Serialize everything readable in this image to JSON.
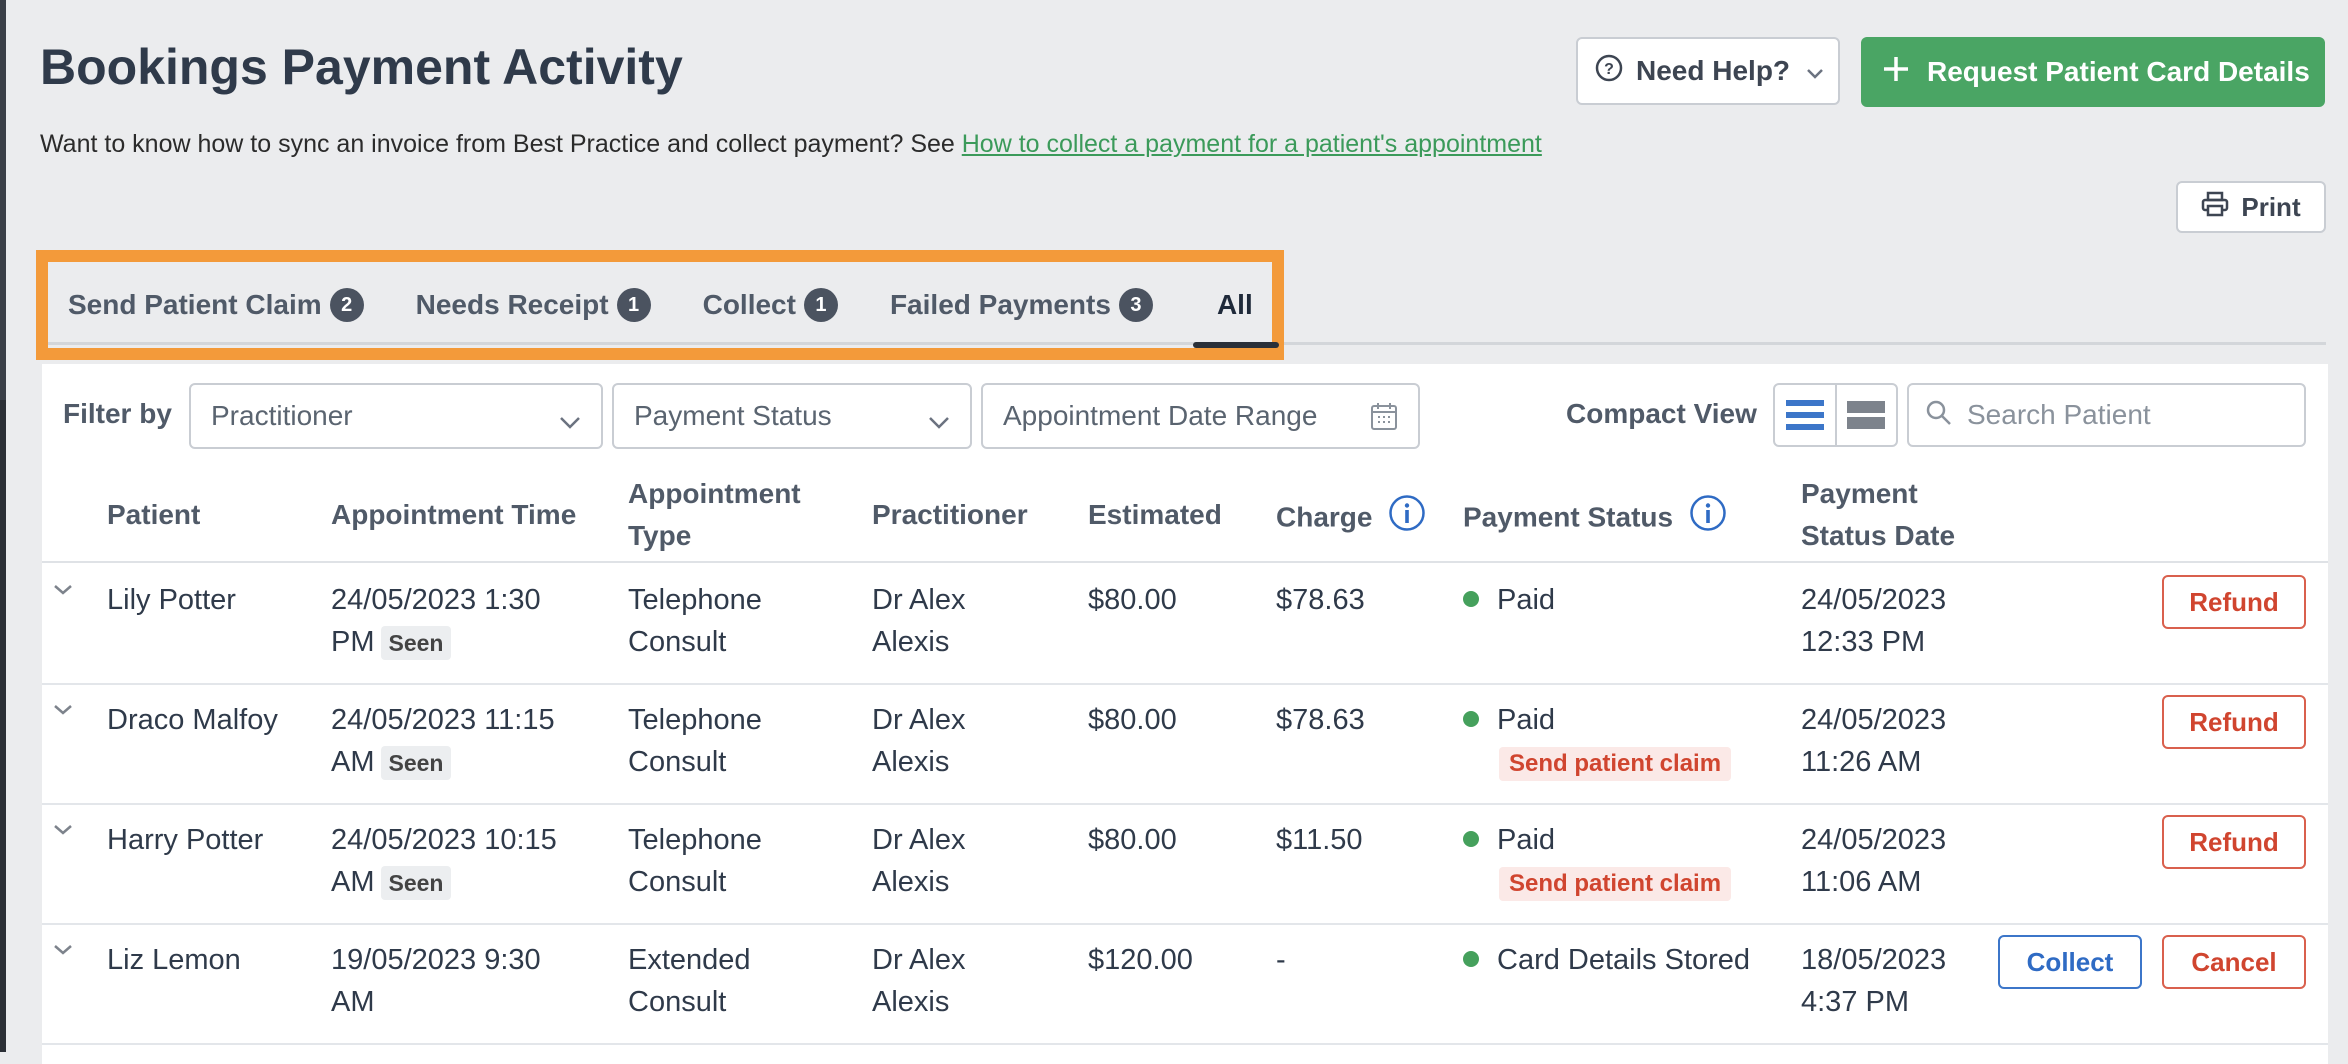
{
  "header": {
    "title": "Bookings Payment Activity",
    "subtext": "Want to know how to sync an invoice from Best Practice and collect payment? See",
    "link_text": "How to collect a payment for a patient's appointment",
    "help_button": "Need Help?",
    "request_button": "Request Patient Card Details",
    "print_button": "Print"
  },
  "tabs": [
    {
      "label": "Send Patient Claim",
      "count": "2"
    },
    {
      "label": "Needs Receipt",
      "count": "1"
    },
    {
      "label": "Collect",
      "count": "1"
    },
    {
      "label": "Failed Payments",
      "count": "3"
    },
    {
      "label": "All",
      "count": ""
    }
  ],
  "filters": {
    "label": "Filter by",
    "practitioner": "Practitioner",
    "payment_status": "Payment Status",
    "date_range": "Appointment Date Range",
    "compact_view": "Compact View",
    "search_placeholder": "Search Patient"
  },
  "columns": {
    "patient": "Patient",
    "appointment_time": "Appointment Time",
    "appointment_type_1": "Appointment",
    "appointment_type_2": "Type",
    "practitioner": "Practitioner",
    "estimated": "Estimated",
    "charge": "Charge",
    "payment_status": "Payment Status",
    "status_date_1": "Payment",
    "status_date_2": "Status Date"
  },
  "rows": [
    {
      "patient": "Lily Potter",
      "time_1": "24/05/2023 1:30",
      "time_2": "PM",
      "seen": "Seen",
      "type_1": "Telephone",
      "type_2": "Consult",
      "prac_1": "Dr Alex",
      "prac_2": "Alexis",
      "estimated": "$80.00",
      "charge": "$78.63",
      "status": "Paid",
      "claim": "",
      "date_1": "24/05/2023",
      "date_2": "12:33 PM",
      "action": "Refund"
    },
    {
      "patient": "Draco Malfoy",
      "time_1": "24/05/2023 11:15",
      "time_2": "AM",
      "seen": "Seen",
      "type_1": "Telephone",
      "type_2": "Consult",
      "prac_1": "Dr Alex",
      "prac_2": "Alexis",
      "estimated": "$80.00",
      "charge": "$78.63",
      "status": "Paid",
      "claim": "Send patient claim",
      "date_1": "24/05/2023",
      "date_2": "11:26 AM",
      "action": "Refund"
    },
    {
      "patient": "Harry Potter",
      "time_1": "24/05/2023 10:15",
      "time_2": "AM",
      "seen": "Seen",
      "type_1": "Telephone",
      "type_2": "Consult",
      "prac_1": "Dr Alex",
      "prac_2": "Alexis",
      "estimated": "$80.00",
      "charge": "$11.50",
      "status": "Paid",
      "claim": "Send patient claim",
      "date_1": "24/05/2023",
      "date_2": "11:06 AM",
      "action": "Refund"
    },
    {
      "patient": "Liz Lemon",
      "time_1": "19/05/2023 9:30",
      "time_2": "AM",
      "seen": "",
      "type_1": "Extended",
      "type_2": "Consult",
      "prac_1": "Dr Alex",
      "prac_2": "Alexis",
      "estimated": "$120.00",
      "charge": "-",
      "status": "Card Details Stored",
      "claim": "",
      "date_1": "18/05/2023",
      "date_2": "4:37 PM",
      "action": "Cancel",
      "secondary_action": "Collect"
    }
  ],
  "colors": {
    "accent_green": "#4aa564",
    "highlight_orange": "#f39a3a",
    "danger": "#d0452f",
    "primary_blue": "#2f6bc4"
  }
}
